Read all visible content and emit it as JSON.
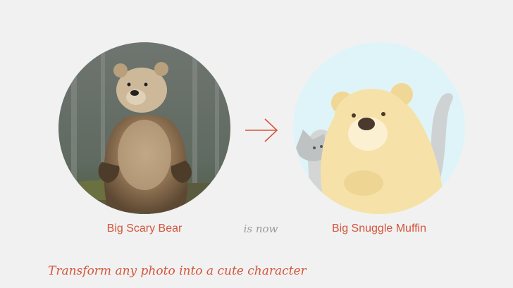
{
  "left_caption": "Big Scary Bear",
  "connector_text": "is now",
  "right_caption": "Big Snuggle Muffin",
  "tagline": "Transform any photo into a cute character",
  "colors": {
    "accent": "#d4543b",
    "muted_text": "#9a9a9a",
    "background": "#f1f1f1",
    "cartoon_bg": "#dff4f8"
  },
  "icons": {
    "arrow": "right-arrow-icon"
  }
}
